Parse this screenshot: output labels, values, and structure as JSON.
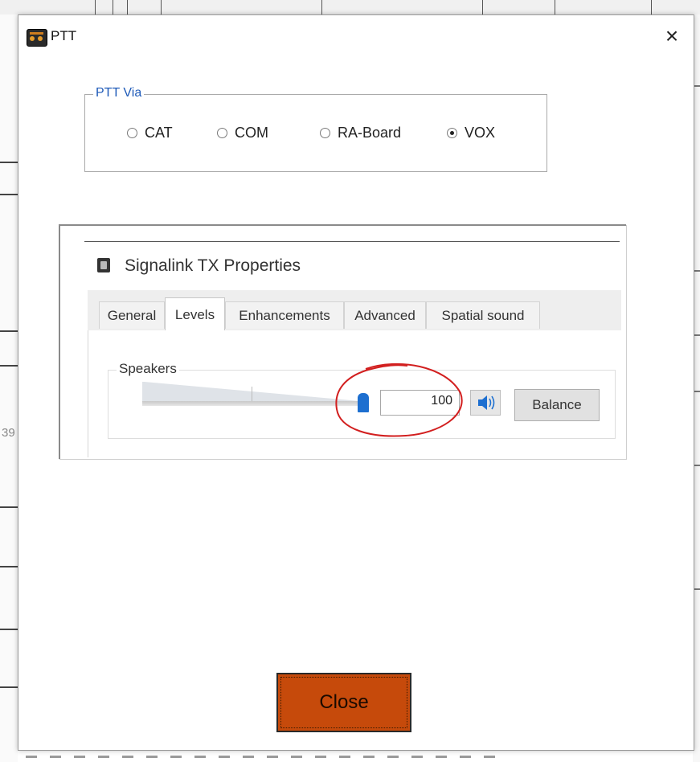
{
  "window": {
    "title": "PTT",
    "app_icon": "radio-icon",
    "close_icon": "close-icon"
  },
  "ptt_via": {
    "label": "PTT Via",
    "options": [
      {
        "label": "CAT",
        "selected": false
      },
      {
        "label": "COM",
        "selected": false
      },
      {
        "label": "RA-Board",
        "selected": false
      },
      {
        "label": "VOX",
        "selected": true
      }
    ]
  },
  "embedded_screenshot": {
    "title": "Signalink TX Properties",
    "tabs": [
      "General",
      "Levels",
      "Enhancements",
      "Advanced",
      "Spatial sound"
    ],
    "active_tab": "Levels",
    "speakers": {
      "label": "Speakers",
      "level": 100,
      "value_text": "100",
      "balance_label": "Balance",
      "mute_icon": "speaker-icon"
    },
    "annotation_color": "#d21f1f"
  },
  "background": {
    "partial_label": "39"
  },
  "close_button": {
    "label": "Close",
    "color": "#c64a0b"
  }
}
